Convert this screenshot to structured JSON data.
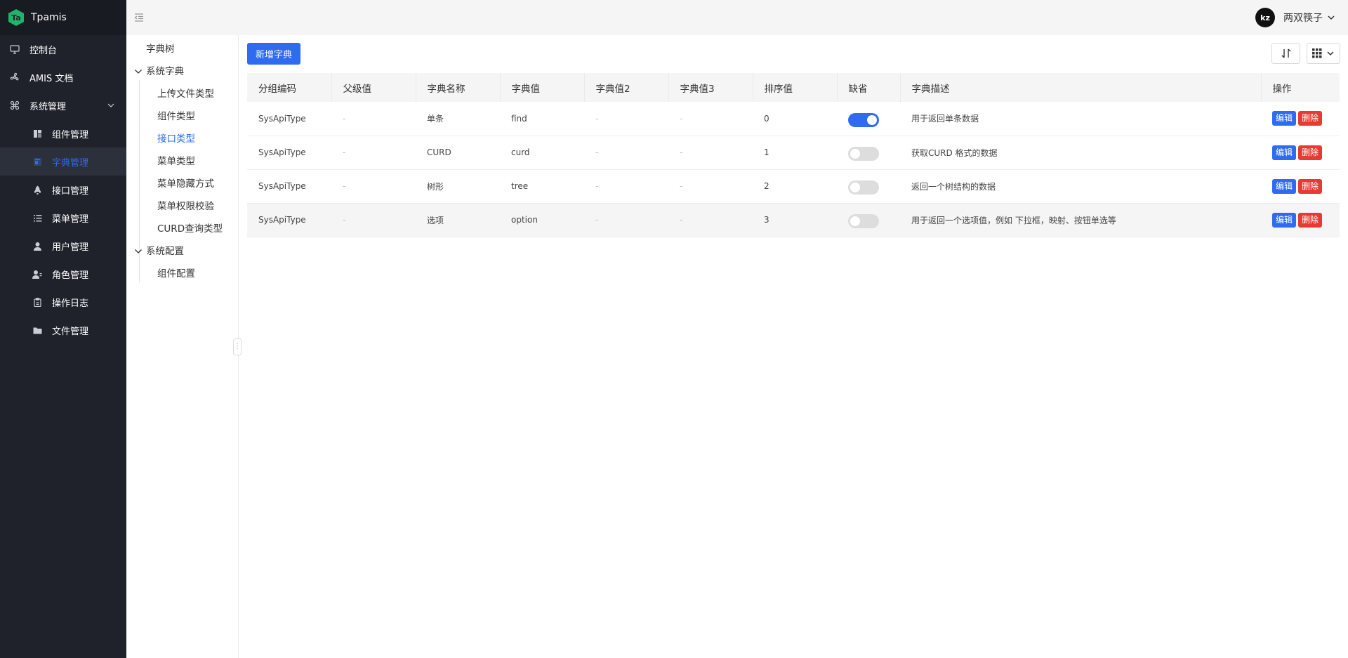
{
  "app": {
    "title": "Tpamis",
    "logo_text": "Ta"
  },
  "sidebar": {
    "items": [
      {
        "label": "控制台",
        "icon": "monitor-icon"
      },
      {
        "label": "AMIS 文档",
        "icon": "fan-icon"
      },
      {
        "label": "系统管理",
        "icon": "command-icon"
      },
      {
        "label": "组件管理",
        "icon": "layout-icon"
      },
      {
        "label": "字典管理",
        "icon": "dictionary-icon"
      },
      {
        "label": "接口管理",
        "icon": "rocket-icon"
      },
      {
        "label": "菜单管理",
        "icon": "list-icon"
      },
      {
        "label": "用户管理",
        "icon": "user-icon"
      },
      {
        "label": "角色管理",
        "icon": "user-role-icon"
      },
      {
        "label": "操作日志",
        "icon": "clipboard-icon"
      },
      {
        "label": "文件管理",
        "icon": "folder-icon"
      }
    ]
  },
  "header": {
    "user_name": "两双筷子",
    "avatar_text": "kz"
  },
  "tree": {
    "root": "字典树",
    "groups": [
      {
        "label": "系统字典",
        "children": [
          "上传文件类型",
          "组件类型",
          "接口类型",
          "菜单类型",
          "菜单隐藏方式",
          "菜单权限校验",
          "CURD查询类型"
        ]
      },
      {
        "label": "系统配置",
        "children": [
          "组件配置"
        ]
      }
    ]
  },
  "toolbar": {
    "add_label": "新增字典"
  },
  "table": {
    "columns": [
      "分组编码",
      "父级值",
      "字典名称",
      "字典值",
      "字典值2",
      "字典值3",
      "排序值",
      "缺省",
      "字典描述",
      "操作"
    ],
    "rows": [
      {
        "group": "SysApiType",
        "parent": "-",
        "name": "单条",
        "value": "find",
        "value2": "-",
        "value3": "-",
        "sort": "0",
        "default": true,
        "desc": "用于返回单条数据"
      },
      {
        "group": "SysApiType",
        "parent": "-",
        "name": "CURD",
        "value": "curd",
        "value2": "-",
        "value3": "-",
        "sort": "1",
        "default": false,
        "desc": "获取CURD 格式的数据"
      },
      {
        "group": "SysApiType",
        "parent": "-",
        "name": "树形",
        "value": "tree",
        "value2": "-",
        "value3": "-",
        "sort": "2",
        "default": false,
        "desc": "返回一个树结构的数据"
      },
      {
        "group": "SysApiType",
        "parent": "-",
        "name": "选项",
        "value": "option",
        "value2": "-",
        "value3": "-",
        "sort": "3",
        "default": false,
        "desc": "用于返回一个选项值，例如 下拉框，映射、按钮单选等"
      }
    ],
    "edit_label": "编辑",
    "delete_label": "删除"
  },
  "colors": {
    "primary": "#2e6bf0",
    "danger": "#e53b32",
    "sidebar_bg": "#1f222b",
    "brand_green": "#1fb36b"
  }
}
